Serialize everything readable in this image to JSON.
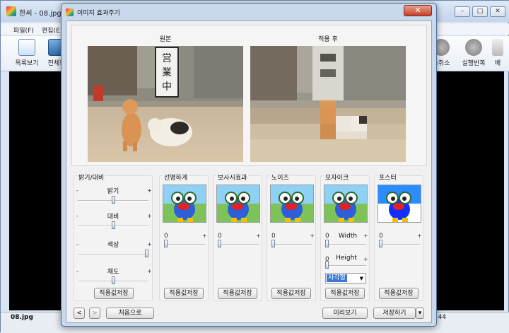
{
  "bg_window": {
    "title": "한씨 - 08.jpg",
    "controls": [
      "–",
      "□",
      "✕"
    ],
    "menu": [
      "파일(F)",
      "편집(E)"
    ],
    "toolbar_left": [
      {
        "label": "목록보기",
        "icon": "list-view-icon"
      },
      {
        "label": "전체화",
        "icon": "fullscreen-icon"
      }
    ],
    "toolbar_right": [
      {
        "label": "동취소",
        "icon": "undo-icon"
      },
      {
        "label": "실행반복",
        "icon": "redo-icon"
      },
      {
        "label": "배",
        "icon": "more-icon"
      }
    ],
    "status_left": "08.jpg",
    "status_right": "44"
  },
  "dialog": {
    "title": "이미지 효과주기",
    "close_label": "✕",
    "preview": {
      "original_label": "원본",
      "after_label": "적용 후"
    },
    "adjust_group": {
      "title": "밝기/대비",
      "sliders": [
        {
          "label": "밝기",
          "minus": "-",
          "plus": "+",
          "value": 0.5
        },
        {
          "label": "대비",
          "minus": "-",
          "plus": "+",
          "value": 0.5
        },
        {
          "label": "색상",
          "minus": "-",
          "plus": "+",
          "value": 1.0
        },
        {
          "label": "채도",
          "minus": "-",
          "plus": "+",
          "value": 0.5
        }
      ],
      "save_label": "적용값저장"
    },
    "effects": [
      {
        "title": "선명하게",
        "value": "0",
        "plus": "+",
        "save_label": "적용값저장"
      },
      {
        "title": "보사시효과",
        "value": "0",
        "plus": "+",
        "save_label": "적용값저장"
      },
      {
        "title": "노이즈",
        "value": "0",
        "plus": "+",
        "save_label": "적용값저장"
      },
      {
        "title": "모자이크",
        "value": "0",
        "plus": "+",
        "width_label": "Width",
        "height_label": "Height",
        "height_value": "0",
        "shape": "사각형",
        "save_label": "적용값저장"
      },
      {
        "title": "포스터",
        "value": "0",
        "plus": "+",
        "save_label": "적용값저장"
      }
    ],
    "footer": {
      "prev": "<",
      "next": ">",
      "reset": "처음으로",
      "preview": "미리보기",
      "save": "저장하기",
      "save_arrow": "▾"
    }
  }
}
